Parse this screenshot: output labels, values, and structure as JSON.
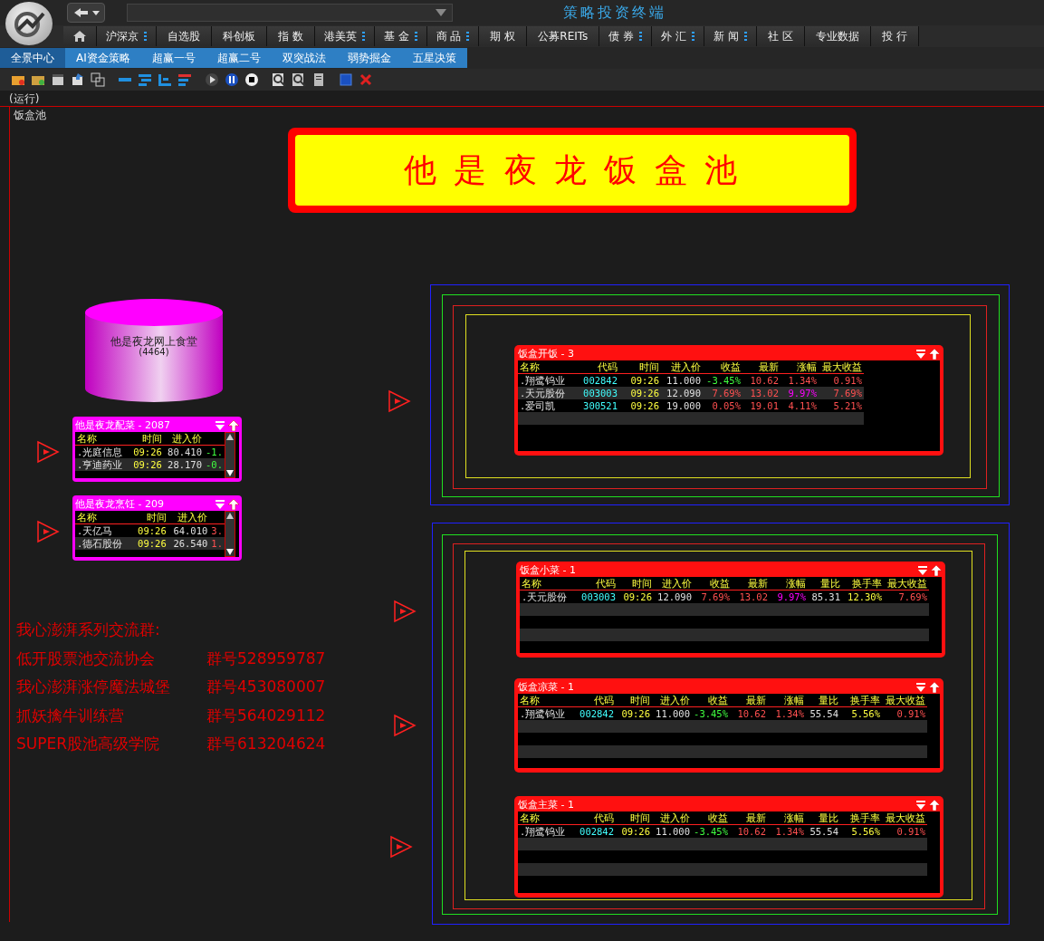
{
  "app_title": "策略投资终端",
  "menu": [
    {
      "label": "沪深京",
      "has_submenu": true
    },
    {
      "label": "自选股",
      "has_submenu": false
    },
    {
      "label": "科创板",
      "has_submenu": false
    },
    {
      "label": "指 数",
      "has_submenu": false
    },
    {
      "label": "港美英",
      "has_submenu": true
    },
    {
      "label": "基 金",
      "has_submenu": true
    },
    {
      "label": "商 品",
      "has_submenu": true
    },
    {
      "label": "期 权",
      "has_submenu": false
    },
    {
      "label": "公募REITs",
      "has_submenu": false
    },
    {
      "label": "债 券",
      "has_submenu": true
    },
    {
      "label": "外 汇",
      "has_submenu": true
    },
    {
      "label": "新 闻",
      "has_submenu": true
    },
    {
      "label": "社 区",
      "has_submenu": false
    },
    {
      "label": "专业数据",
      "has_submenu": false
    },
    {
      "label": "投 行",
      "has_submenu": false
    }
  ],
  "tabs": [
    {
      "label": "全景中心",
      "selected": true
    },
    {
      "label": "AI资金策略",
      "selected": false
    },
    {
      "label": "超赢一号",
      "selected": false
    },
    {
      "label": "超赢二号",
      "selected": false
    },
    {
      "label": "双突战法",
      "selected": false
    },
    {
      "label": "弱势掘金",
      "selected": false
    },
    {
      "label": "五星决策",
      "selected": false
    }
  ],
  "status": "(运行)",
  "canvas_title": "饭盒池",
  "banner": "他 是 夜 龙 饭 盒 池",
  "pool": {
    "label": "他是夜龙网上食堂",
    "count": "(4464)"
  },
  "small_panels": [
    {
      "title": "他是夜龙配菜 - 2087",
      "columns": [
        "名称",
        "时间",
        "进入价"
      ],
      "rows": [
        [
          ".光庭信息",
          "09:26",
          "80.410",
          {
            "text": "-1.",
            "rising": false
          }
        ],
        [
          ".亨迪药业",
          "09:26",
          "28.170",
          {
            "text": "-0.",
            "rising": false
          }
        ]
      ]
    },
    {
      "title": "他是夜龙烹饪 - 209",
      "columns": [
        "名称",
        "时间",
        "进入价"
      ],
      "rows": [
        [
          ".天亿马",
          "09:26",
          "64.010",
          {
            "text": "3.",
            "rising": true
          }
        ],
        [
          ".德石股份",
          "09:26",
          "26.540",
          {
            "text": "1.",
            "rising": true
          }
        ]
      ]
    }
  ],
  "panels": [
    {
      "title": "饭盒开饭 - 3",
      "columns": [
        "名称",
        "代码",
        "时间",
        "进入价",
        "收益",
        "最新",
        "涨幅",
        "最大收益"
      ],
      "rows": [
        [
          ".翔鹭钨业",
          "002842",
          "09:26",
          "11.000",
          {
            "text": "-3.45%",
            "rising": false
          },
          {
            "text": "10.62",
            "rising": true
          },
          {
            "text": "1.34%",
            "rising": true,
            "limit_up": false
          },
          {
            "text": "0.91%",
            "rising": true
          }
        ],
        [
          ".天元股份",
          "003003",
          "09:26",
          "12.090",
          {
            "text": "7.69%",
            "rising": true
          },
          {
            "text": "13.02",
            "rising": true
          },
          {
            "text": "9.97%",
            "rising": true,
            "limit_up": true
          },
          {
            "text": "7.69%",
            "rising": true
          }
        ],
        [
          ".爱司凯",
          "300521",
          "09:26",
          "19.000",
          {
            "text": "0.05%",
            "rising": true
          },
          {
            "text": "19.01",
            "rising": true
          },
          {
            "text": "4.11%",
            "rising": true,
            "limit_up": false
          },
          {
            "text": "5.21%",
            "rising": true
          }
        ]
      ]
    },
    {
      "title": "饭盒小菜 - 1",
      "columns": [
        "名称",
        "代码",
        "时间",
        "进入价",
        "收益",
        "最新",
        "涨幅",
        "量比",
        "换手率",
        "最大收益"
      ],
      "rows": [
        [
          ".天元股份",
          "003003",
          "09:26",
          "12.090",
          {
            "text": "7.69%",
            "rising": true
          },
          {
            "text": "13.02",
            "rising": true
          },
          {
            "text": "9.97%",
            "rising": true,
            "limit_up": true
          },
          "85.31",
          "12.30%",
          {
            "text": "7.69%",
            "rising": true
          }
        ]
      ]
    },
    {
      "title": "饭盒凉菜 - 1",
      "columns": [
        "名称",
        "代码",
        "时间",
        "进入价",
        "收益",
        "最新",
        "涨幅",
        "量比",
        "换手率",
        "最大收益"
      ],
      "rows": [
        [
          ".翔鹭钨业",
          "002842",
          "09:26",
          "11.000",
          {
            "text": "-3.45%",
            "rising": false
          },
          {
            "text": "10.62",
            "rising": true
          },
          {
            "text": "1.34%",
            "rising": true,
            "limit_up": false
          },
          "55.54",
          "5.56%",
          {
            "text": "0.91%",
            "rising": true
          }
        ]
      ]
    },
    {
      "title": "饭盒主菜 - 1",
      "columns": [
        "名称",
        "代码",
        "时间",
        "进入价",
        "收益",
        "最新",
        "涨幅",
        "量比",
        "换手率",
        "最大收益"
      ],
      "rows": [
        [
          ".翔鹭钨业",
          "002842",
          "09:26",
          "11.000",
          {
            "text": "-3.45%",
            "rising": false
          },
          {
            "text": "10.62",
            "rising": true
          },
          {
            "text": "1.34%",
            "rising": true,
            "limit_up": false
          },
          "55.54",
          "5.56%",
          {
            "text": "0.91%",
            "rising": true
          }
        ]
      ]
    }
  ],
  "groups": {
    "heading": "我心澎湃系列交流群:",
    "items": [
      {
        "name": "低开股票池交流协会",
        "number": "群号528959787"
      },
      {
        "name": "我心澎湃涨停魔法城堡",
        "number": "群号453080007"
      },
      {
        "name": "抓妖擒牛训练营",
        "number": "群号564029112"
      },
      {
        "name": "SUPER股池高级学院",
        "number": "群号613204624"
      }
    ]
  }
}
